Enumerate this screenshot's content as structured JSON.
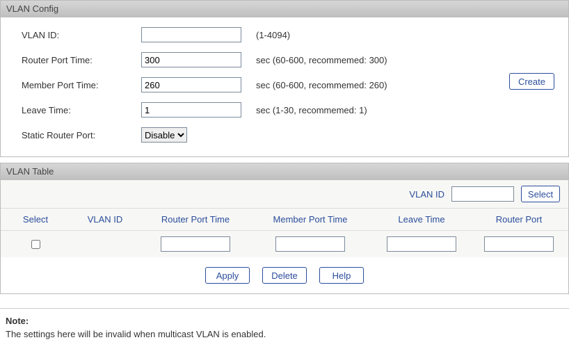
{
  "config": {
    "title": "VLAN Config",
    "vlan_id_label": "VLAN ID:",
    "vlan_id_value": "",
    "vlan_id_hint": "(1-4094)",
    "router_port_time_label": "Router Port Time:",
    "router_port_time_value": "300",
    "router_port_time_hint": "sec (60-600, recommemed: 300)",
    "member_port_time_label": "Member Port Time:",
    "member_port_time_value": "260",
    "member_port_time_hint": "sec (60-600, recommemed: 260)",
    "leave_time_label": "Leave Time:",
    "leave_time_value": "1",
    "leave_time_hint": "sec (1-30, recommemed: 1)",
    "static_router_port_label": "Static Router Port:",
    "static_router_port_value": "Disable",
    "create_btn": "Create"
  },
  "table": {
    "title": "VLAN Table",
    "search_label": "VLAN ID",
    "search_value": "",
    "select_btn": "Select",
    "headers": {
      "select": "Select",
      "vlan_id": "VLAN ID",
      "router_port_time": "Router Port Time",
      "member_port_time": "Member Port Time",
      "leave_time": "Leave Time",
      "router_port": "Router Port"
    },
    "row": {
      "router_port_time": "",
      "member_port_time": "",
      "leave_time": "",
      "router_port": ""
    },
    "apply_btn": "Apply",
    "delete_btn": "Delete",
    "help_btn": "Help"
  },
  "note": {
    "title": "Note:",
    "text": "The settings here will be invalid when multicast VLAN is enabled."
  }
}
